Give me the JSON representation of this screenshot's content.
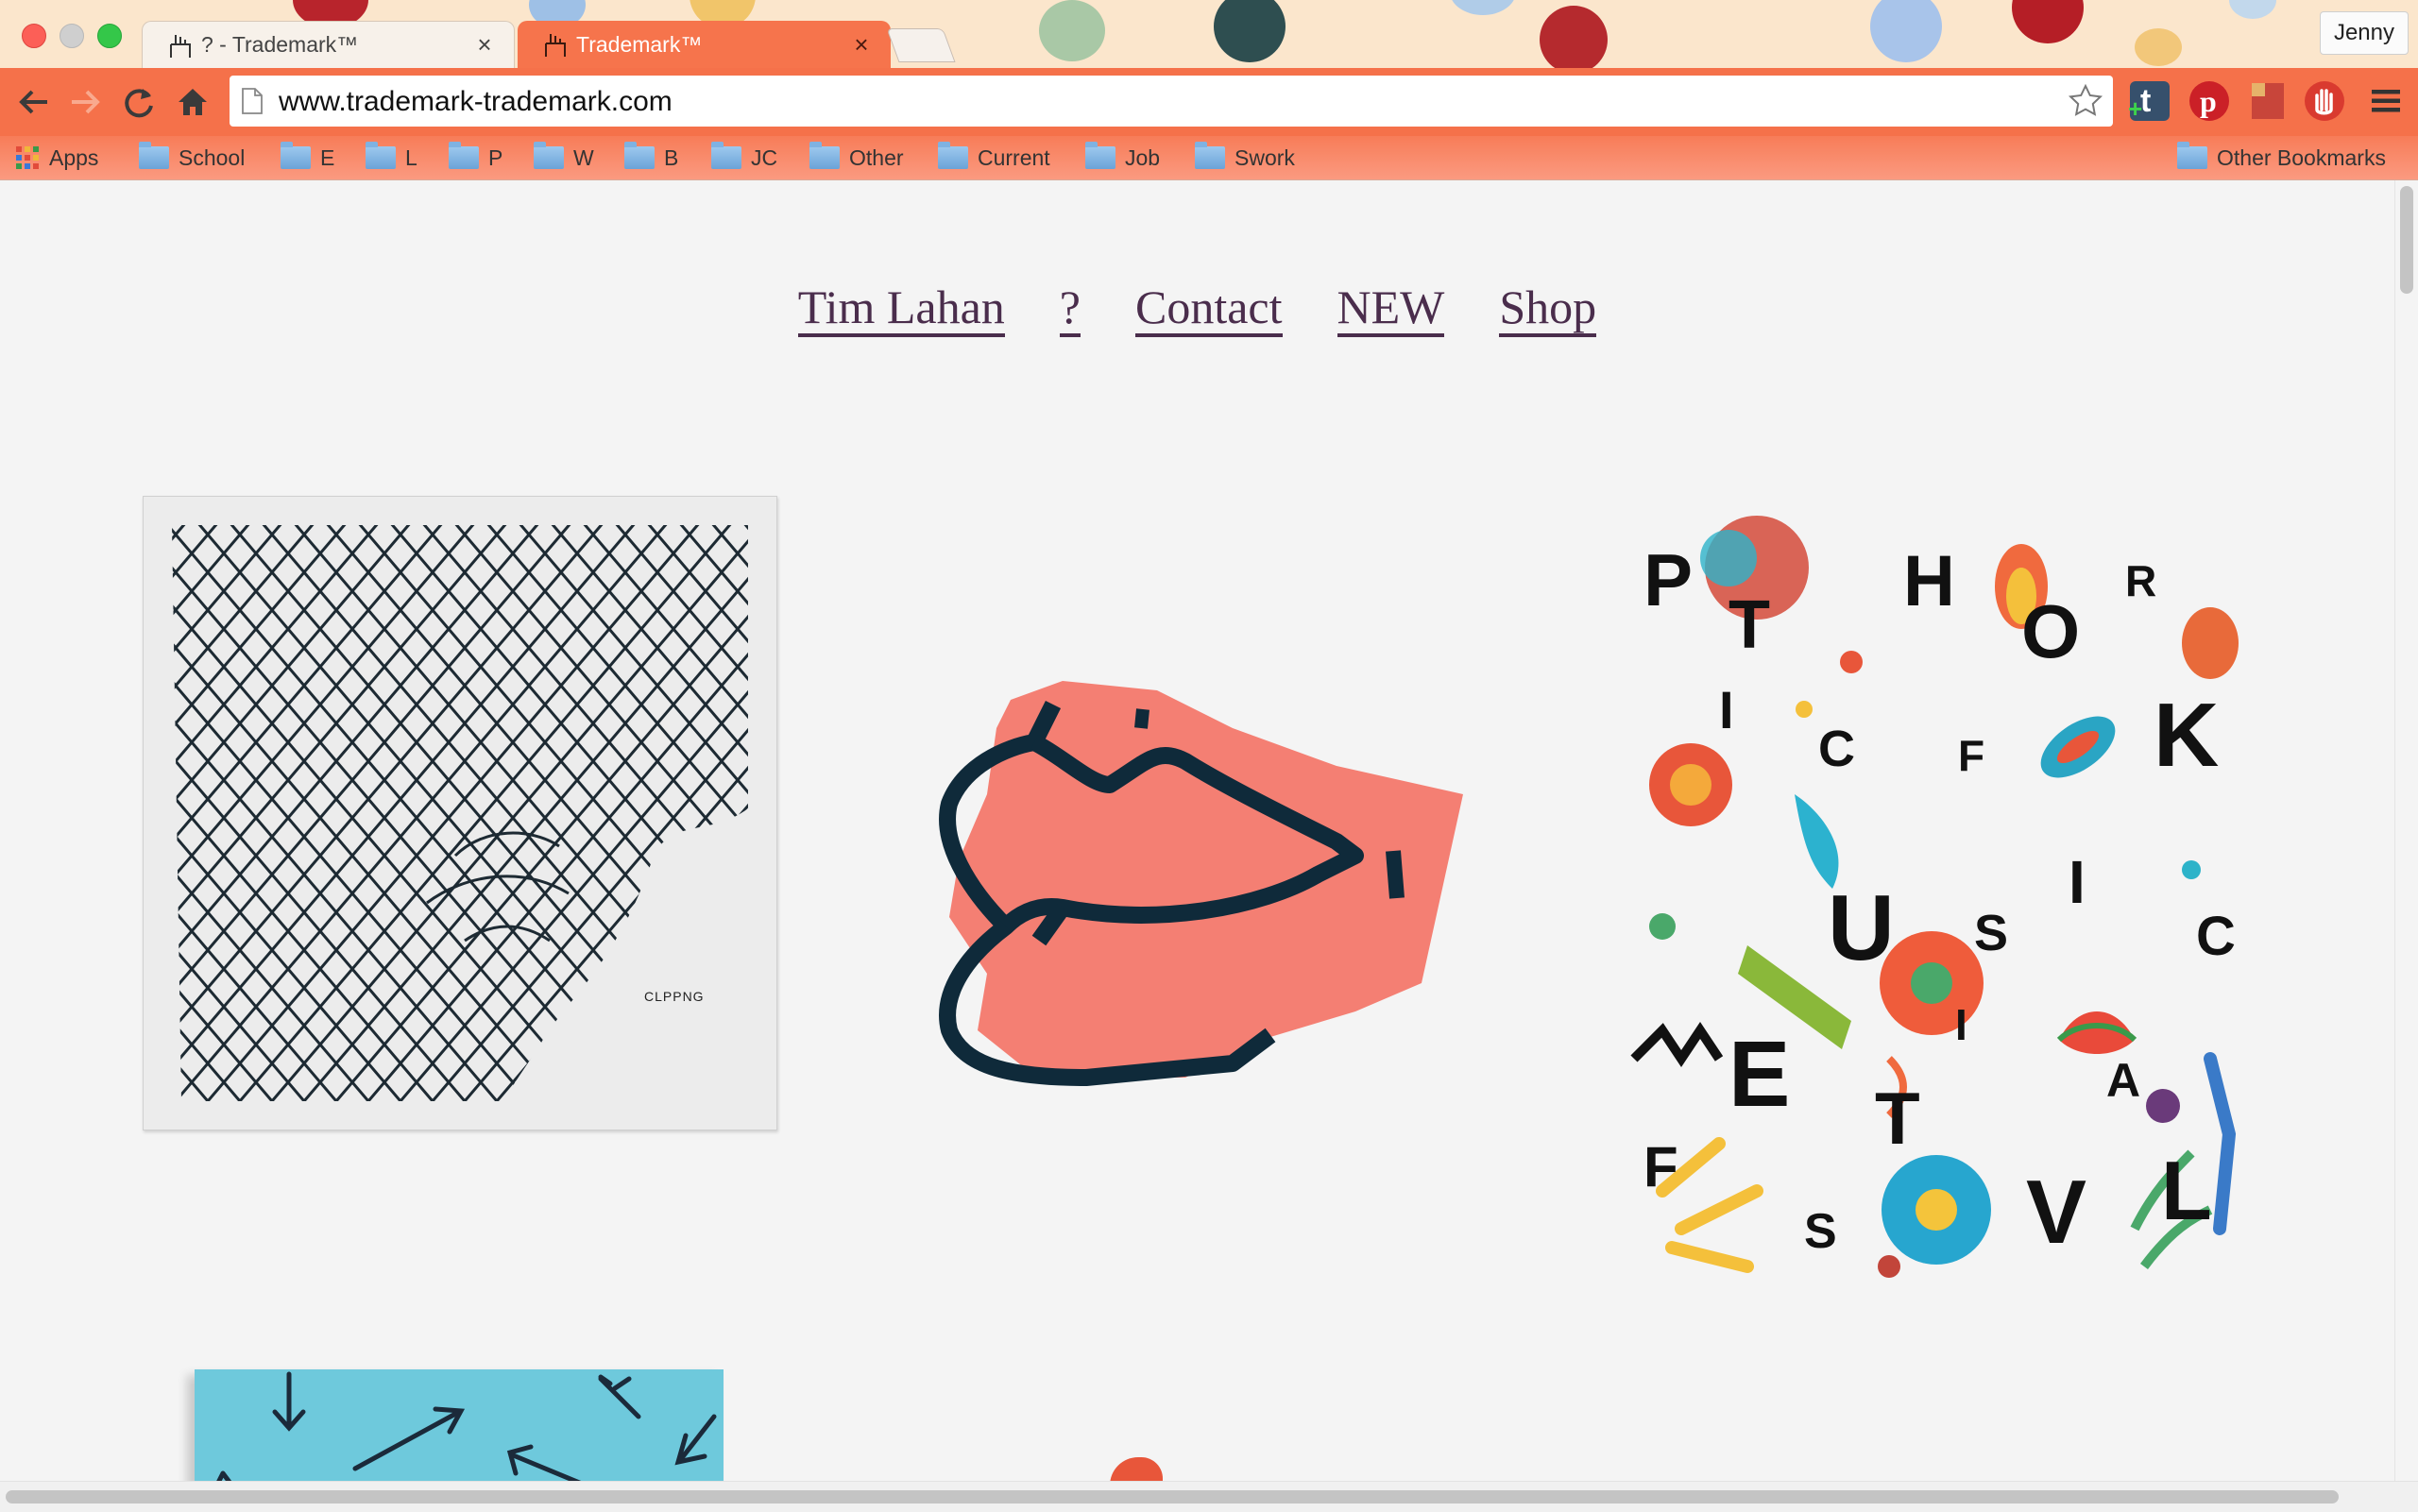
{
  "browser": {
    "tabs": [
      {
        "title": "? - Trademark™",
        "close": "×"
      },
      {
        "title": "Trademark™",
        "close": "×"
      }
    ],
    "profile_name": "Jenny",
    "url": "www.trademark-trademark.com",
    "bookmarks": [
      "Apps",
      "School",
      "E",
      "L",
      "P",
      "W",
      "B",
      "JC",
      "Other",
      "Current",
      "Job",
      "Swork"
    ],
    "other_bookmarks": "Other Bookmarks"
  },
  "site": {
    "nav": [
      "Tim Lahan",
      "?",
      "Contact",
      "NEW",
      "Shop"
    ],
    "tiles": {
      "fence_caption": "CLPPNG",
      "poster_letters": [
        "P",
        "T",
        "H",
        "O",
        "R",
        "I",
        "C",
        "F",
        "K",
        "U",
        "S",
        "I",
        "C",
        "E",
        "T",
        "I",
        "A",
        "F",
        "S",
        "V",
        "L"
      ]
    }
  },
  "colors": {
    "tab_active": "#f6744c",
    "toolbar": "#f5714a",
    "nav_text": "#4a2d4c",
    "lips_fill": "#f47f73",
    "lips_stroke": "#0f2a3a",
    "tile_blue": "#6ec9dc"
  }
}
